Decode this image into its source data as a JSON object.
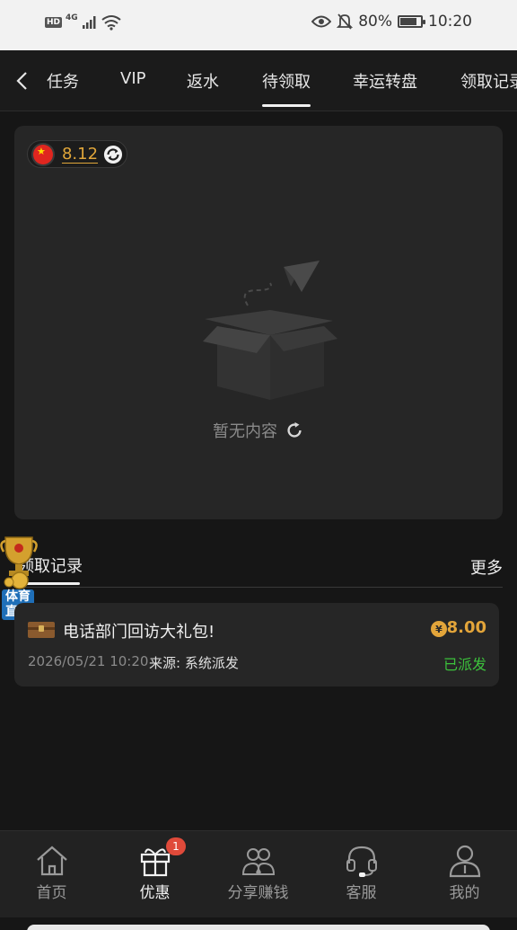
{
  "status_bar": {
    "hd": "HD",
    "network": "4G",
    "battery_percent": "80%",
    "battery_level": 0.8,
    "time": "10:20"
  },
  "top_tabs": [
    {
      "label": "任务"
    },
    {
      "label": "VIP"
    },
    {
      "label": "返水"
    },
    {
      "label": "待领取",
      "active": true
    },
    {
      "label": "幸运转盘"
    },
    {
      "label": "领取记录"
    }
  ],
  "balance": {
    "value": "8.12"
  },
  "empty_state": {
    "text": "暂无内容"
  },
  "records": {
    "title": "领取记录",
    "more": "更多",
    "items": [
      {
        "name": "电话部门回访大礼包!",
        "currency_symbol": "¥",
        "amount": "8.00",
        "date": "2026/05/21 10:20",
        "source": "来源: 系统派发",
        "status": "已派发"
      }
    ]
  },
  "floating_badge": {
    "label": "体育直播"
  },
  "bottom_nav": [
    {
      "label": "首页",
      "icon": "home-icon"
    },
    {
      "label": "优惠",
      "icon": "gift-icon",
      "active": true,
      "badge": "1"
    },
    {
      "label": "分享赚钱",
      "icon": "share-people-icon"
    },
    {
      "label": "客服",
      "icon": "headset-icon"
    },
    {
      "label": "我的",
      "icon": "user-icon"
    }
  ],
  "colors": {
    "accent": "#e3a53a",
    "status_green": "#3cc23c",
    "badge_red": "#e04a3a"
  }
}
